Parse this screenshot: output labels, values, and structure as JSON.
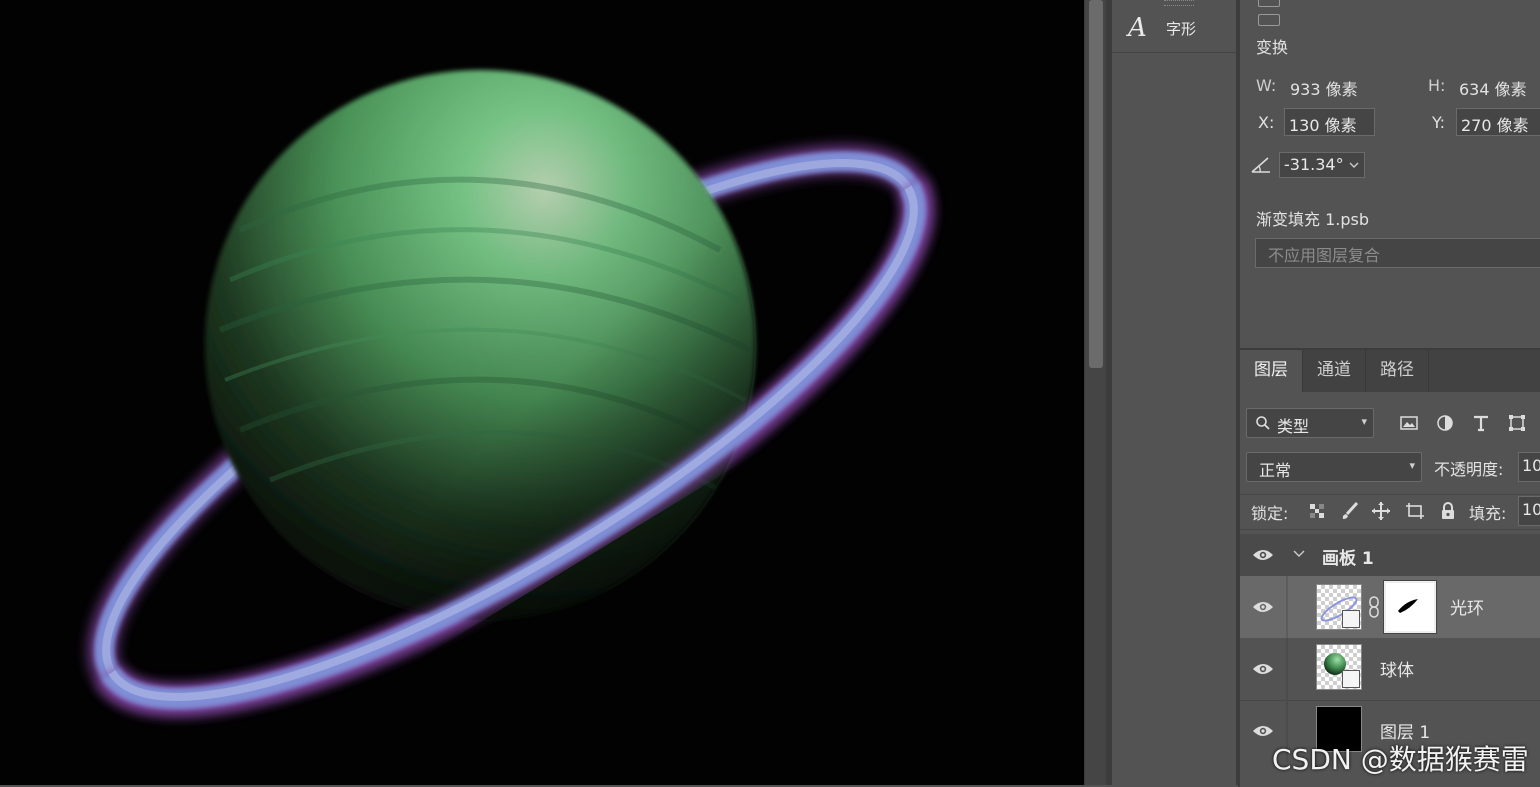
{
  "dock": {
    "glyph_panel_label": "字形",
    "glyph_icon": "A"
  },
  "properties": {
    "section_title": "变换",
    "w_label": "W:",
    "w_value": "933 像素",
    "h_label": "H:",
    "h_value": "634 像素",
    "x_label": "X:",
    "x_value": "130 像素",
    "y_label": "Y:",
    "y_value": "270 像素",
    "angle_value": "-31.34°",
    "smart_object_name": "渐变填充 1.psb",
    "layer_comp_placeholder": "不应用图层复合"
  },
  "layers": {
    "tabs": [
      {
        "label": "图层"
      },
      {
        "label": "通道"
      },
      {
        "label": "路径"
      }
    ],
    "filter_kind": "类型",
    "blend_mode": "正常",
    "opacity_label": "不透明度:",
    "opacity_value": "10",
    "lock_label": "锁定:",
    "fill_label": "填充:",
    "fill_value": "10",
    "group_name": "画板 1",
    "items": [
      {
        "name": "光环"
      },
      {
        "name": "球体"
      },
      {
        "name": "图层 1"
      }
    ]
  },
  "watermark": "CSDN @数据猴赛雷",
  "colors": {
    "canvas_bg": "#020202",
    "panel_bg": "#535353",
    "selected_row": "#696969"
  }
}
